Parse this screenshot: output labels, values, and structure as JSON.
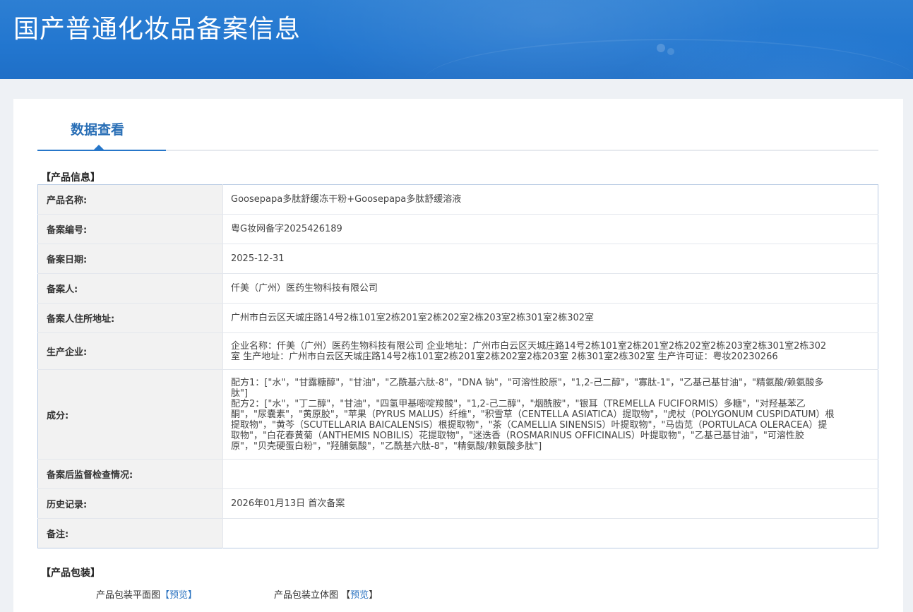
{
  "header": {
    "title": "国产普通化妆品备案信息"
  },
  "tabs": [
    {
      "label": "数据查看",
      "active": true
    }
  ],
  "product_info": {
    "section_title": "【产品信息】",
    "rows": [
      {
        "key": "产品名称:",
        "value": "Goosepapa多肽舒缓冻干粉+Goosepapa多肽舒缓溶液"
      },
      {
        "key": "备案编号:",
        "value": "粤G妆网备字2025426189"
      },
      {
        "key": "备案日期:",
        "value": "2025-12-31"
      },
      {
        "key": "备案人:",
        "value": "仟美（广州）医药生物科技有限公司"
      },
      {
        "key": "备案人住所地址:",
        "value": "广州市白云区天城庄路14号2栋101室2栋201室2栋202室2栋203室2栋301室2栋302室"
      },
      {
        "key": "生产企业:",
        "value": "企业名称：仟美（广州）医药生物科技有限公司 企业地址：广州市白云区天城庄路14号2栋101室2栋201室2栋202室2栋203室2栋301室2栋302室 生产地址：广州市白云区天城庄路14号2栋101室2栋201室2栋202室2栋203室 2栋301室2栋302室 生产许可证：粤妆20230266"
      },
      {
        "key": "成分:",
        "value_lines": [
          "配方1：[\"水\"，\"甘露糖醇\"，\"甘油\"，\"乙酰基六肽-8\"，\"DNA 钠\"，\"可溶性胶原\"，\"1,2-己二醇\"，\"寡肽-1\"，\"乙基己基甘油\"，\"精氨酸/赖氨酸多肽\"]",
          "配方2：[\"水\"，\"丁二醇\"，\"甘油\"，\"四氢甲基嘧啶羧酸\"，\"1,2-己二醇\"，\"烟酰胺\"，\"银耳（TREMELLA FUCIFORMIS）多糖\"，\"对羟基苯乙酮\"，\"尿囊素\"，\"黄原胶\"，\"苹果（PYRUS MALUS）纤维\"，\"积雪草（CENTELLA ASIATICA）提取物\"，\"虎杖（POLYGONUM CUSPIDATUM）根提取物\"，\"黄芩（SCUTELLARIA BAICALENSIS）根提取物\"，\"茶（CAMELLIA SINENSIS）叶提取物\"，\"马齿苋（PORTULACA OLERACEA）提取物\"，\"白花春黄菊（ANTHEMIS NOBILIS）花提取物\"，\"迷迭香（ROSMARINUS OFFICINALIS）叶提取物\"，\"乙基己基甘油\"，\"可溶性胶原\"，\"贝壳硬蛋白粉\"，\"羟脯氨酸\"，\"乙酰基六肽-8\"，\"精氨酸/赖氨酸多肽\"]"
        ]
      },
      {
        "key": "备案后监督检查情况:",
        "value": ""
      },
      {
        "key": "历史记录:",
        "value": "2026年01月13日 首次备案"
      },
      {
        "key": "备注:",
        "value": ""
      }
    ]
  },
  "packaging": {
    "section_title": "【产品包装】",
    "flat_label": "产品包装平面图",
    "flat_link": "【预览】",
    "solid_label": "产品包装立体图",
    "solid_link_prefix": "【",
    "solid_link_text": "预览",
    "solid_link_suffix": "】"
  },
  "colors": {
    "banner": "#2276cf",
    "accent": "#2676c9",
    "link": "#2a72c0"
  }
}
